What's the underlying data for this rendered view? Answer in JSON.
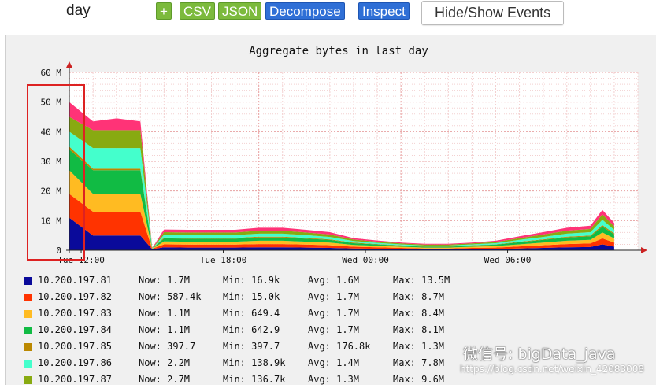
{
  "toolbar": {
    "period": "day",
    "plus_label": "+",
    "csv_label": "CSV",
    "json_label": "JSON",
    "decompose_label": "Decompose",
    "inspect_label": "Inspect",
    "hide_show_label": "Hide/Show Events"
  },
  "watermark": {
    "line1": "微信号: bigData_java",
    "line2": "https://blog.csdn.net/weixin_42083008"
  },
  "chart_data": {
    "type": "area",
    "title": "Aggregate bytes_in last day",
    "xlabel": "",
    "ylabel": "",
    "y_unit": "M",
    "ylim": [
      0,
      60
    ],
    "y_ticks": [
      "0",
      "10 M",
      "20 M",
      "30 M",
      "40 M",
      "50 M",
      "60 M"
    ],
    "x_ticks": [
      "Tue 12:00",
      "Tue 18:00",
      "Wed 00:00",
      "Wed 06:00"
    ],
    "x_hours": [
      0,
      1,
      2,
      3,
      3.5,
      3.6,
      4,
      5,
      6,
      7,
      8,
      9,
      10,
      11,
      12,
      13,
      14,
      15,
      16,
      17,
      18,
      19,
      20,
      21,
      22,
      22.5,
      23
    ],
    "grid": true,
    "legend_position": "bottom",
    "series": [
      {
        "name": "10.200.197.81",
        "color": "#0a0a9a",
        "now": "1.7M",
        "min": "16.9k",
        "avg": "1.6M",
        "max": "13.5M",
        "values": [
          11,
          5,
          5,
          5,
          0.3,
          0.5,
          1.0,
          0.9,
          0.9,
          0.9,
          1.0,
          1.0,
          0.9,
          0.8,
          0.6,
          0.5,
          0.4,
          0.3,
          0.3,
          0.4,
          0.4,
          0.6,
          0.8,
          1.0,
          1.1,
          2.0,
          1.2
        ]
      },
      {
        "name": "10.200.197.82",
        "color": "#ff3300",
        "now": "587.4k",
        "min": "15.0k",
        "avg": "1.7M",
        "max": "8.7M",
        "values": [
          8,
          8,
          8,
          8,
          0.1,
          0.3,
          1.0,
          1.0,
          1.0,
          1.0,
          1.1,
          1.1,
          1.0,
          0.9,
          0.6,
          0.5,
          0.4,
          0.3,
          0.3,
          0.4,
          0.5,
          0.7,
          0.9,
          1.1,
          1.2,
          2.0,
          1.4
        ]
      },
      {
        "name": "10.200.197.83",
        "color": "#ffbb22",
        "now": "1.1M",
        "min": "649.4",
        "avg": "1.7M",
        "max": "8.4M",
        "values": [
          8,
          6,
          6,
          6,
          0.1,
          0.2,
          1.0,
          1.0,
          1.0,
          1.0,
          1.1,
          1.1,
          1.0,
          0.9,
          0.6,
          0.5,
          0.4,
          0.3,
          0.3,
          0.4,
          0.5,
          0.7,
          0.9,
          1.1,
          1.2,
          2.0,
          1.4
        ]
      },
      {
        "name": "10.200.197.84",
        "color": "#11bb44",
        "now": "1.1M",
        "min": "642.9",
        "avg": "1.7M",
        "max": "8.1M",
        "values": [
          7,
          8,
          8,
          8,
          0.1,
          0.2,
          1.0,
          1.0,
          1.0,
          1.0,
          1.1,
          1.1,
          1.0,
          0.9,
          0.6,
          0.5,
          0.4,
          0.3,
          0.3,
          0.4,
          0.5,
          0.7,
          0.9,
          1.1,
          1.2,
          2.0,
          1.4
        ]
      },
      {
        "name": "10.200.197.85",
        "color": "#bb8800",
        "now": "397.7",
        "min": "397.7",
        "avg": "176.8k",
        "max": "1.3M",
        "values": [
          1,
          0.5,
          0.5,
          0.5,
          0.05,
          0.1,
          0.3,
          0.3,
          0.3,
          0.3,
          0.3,
          0.3,
          0.3,
          0.2,
          0.2,
          0.1,
          0.1,
          0.1,
          0.1,
          0.1,
          0.1,
          0.2,
          0.2,
          0.3,
          0.3,
          0.5,
          0.3
        ]
      },
      {
        "name": "10.200.197.86",
        "color": "#44ffcc",
        "now": "2.2M",
        "min": "138.9k",
        "avg": "1.4M",
        "max": "7.8M",
        "values": [
          5,
          7,
          7,
          7,
          0.1,
          0.2,
          0.9,
          0.9,
          0.9,
          0.9,
          1.0,
          1.0,
          0.9,
          0.8,
          0.5,
          0.4,
          0.3,
          0.3,
          0.3,
          0.3,
          0.4,
          0.6,
          0.8,
          1.0,
          1.1,
          1.8,
          1.2
        ]
      },
      {
        "name": "10.200.197.87",
        "color": "#88aa11",
        "now": "2.7M",
        "min": "136.7k",
        "avg": "1.3M",
        "max": "9.6M",
        "values": [
          5,
          6,
          6,
          6,
          0.1,
          0.2,
          0.9,
          0.9,
          0.9,
          0.9,
          1.0,
          1.0,
          0.9,
          0.8,
          0.5,
          0.4,
          0.3,
          0.3,
          0.3,
          0.3,
          0.4,
          0.6,
          0.8,
          1.0,
          1.1,
          1.8,
          1.2
        ]
      },
      {
        "name": "",
        "color": "#ff3377",
        "now": "",
        "min": "",
        "avg": "",
        "max": "",
        "values": [
          5,
          3,
          4,
          3,
          0.1,
          0.3,
          0.9,
          0.9,
          0.9,
          0.9,
          1.0,
          1.0,
          0.9,
          0.8,
          0.5,
          0.4,
          0.3,
          0.3,
          0.3,
          0.3,
          0.4,
          0.6,
          0.8,
          1.0,
          1.1,
          1.5,
          1.1
        ]
      }
    ],
    "highlight": {
      "color": "#dd2222"
    }
  },
  "legend_labels": {
    "now": "Now:",
    "min": "Min:",
    "avg": "Avg:",
    "max": "Max:"
  }
}
